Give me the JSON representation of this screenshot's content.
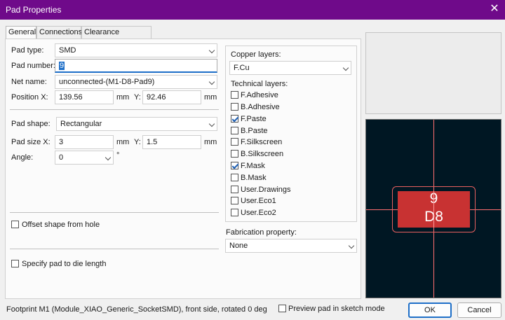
{
  "window": {
    "title": "Pad Properties",
    "close_glyph": "✕"
  },
  "tabs": [
    {
      "label": "General"
    },
    {
      "label": "Connections"
    },
    {
      "label": "Clearance Overrides"
    }
  ],
  "general": {
    "pad_type": {
      "label": "Pad type:",
      "value": "SMD"
    },
    "pad_number": {
      "label": "Pad number:",
      "value": "9"
    },
    "net_name": {
      "label": "Net name:",
      "value": "unconnected-(M1-D8-Pad9)"
    },
    "position": {
      "label": "Position X:",
      "x_value": "139.56",
      "x_unit": "mm",
      "y_label": "Y:",
      "y_value": "92.46",
      "y_unit": "mm"
    },
    "pad_shape": {
      "label": "Pad shape:",
      "value": "Rectangular"
    },
    "pad_size": {
      "label": "Pad size X:",
      "x_value": "3",
      "x_unit": "mm",
      "y_label": "Y:",
      "y_value": "1.5",
      "y_unit": "mm"
    },
    "angle": {
      "label": "Angle:",
      "value": "0",
      "unit": "°"
    },
    "offset_shape": {
      "label": "Offset shape from hole",
      "checked": false
    },
    "die_length": {
      "label": "Specify pad to die length",
      "checked": false
    }
  },
  "layers": {
    "copper_label": "Copper layers:",
    "copper_value": "F.Cu",
    "technical_label": "Technical layers:",
    "items": [
      {
        "label": "F.Adhesive",
        "checked": false
      },
      {
        "label": "B.Adhesive",
        "checked": false
      },
      {
        "label": "F.Paste",
        "checked": true
      },
      {
        "label": "B.Paste",
        "checked": false
      },
      {
        "label": "F.Silkscreen",
        "checked": false
      },
      {
        "label": "B.Silkscreen",
        "checked": false
      },
      {
        "label": "F.Mask",
        "checked": true
      },
      {
        "label": "B.Mask",
        "checked": false
      },
      {
        "label": "User.Drawings",
        "checked": false
      },
      {
        "label": "User.Eco1",
        "checked": false
      },
      {
        "label": "User.Eco2",
        "checked": false
      }
    ]
  },
  "fabrication": {
    "label": "Fabrication property:",
    "value": "None"
  },
  "preview": {
    "pad_number": "9",
    "net_label": "D8",
    "pad_color": "#c83232",
    "background": "#001723"
  },
  "footer": {
    "status": "Footprint M1 (Module_XIAO_Generic_SocketSMD), front side, rotated 0 deg",
    "sketch_mode": {
      "label": "Preview pad in sketch mode",
      "checked": false
    },
    "ok_label": "OK",
    "cancel_label": "Cancel"
  }
}
